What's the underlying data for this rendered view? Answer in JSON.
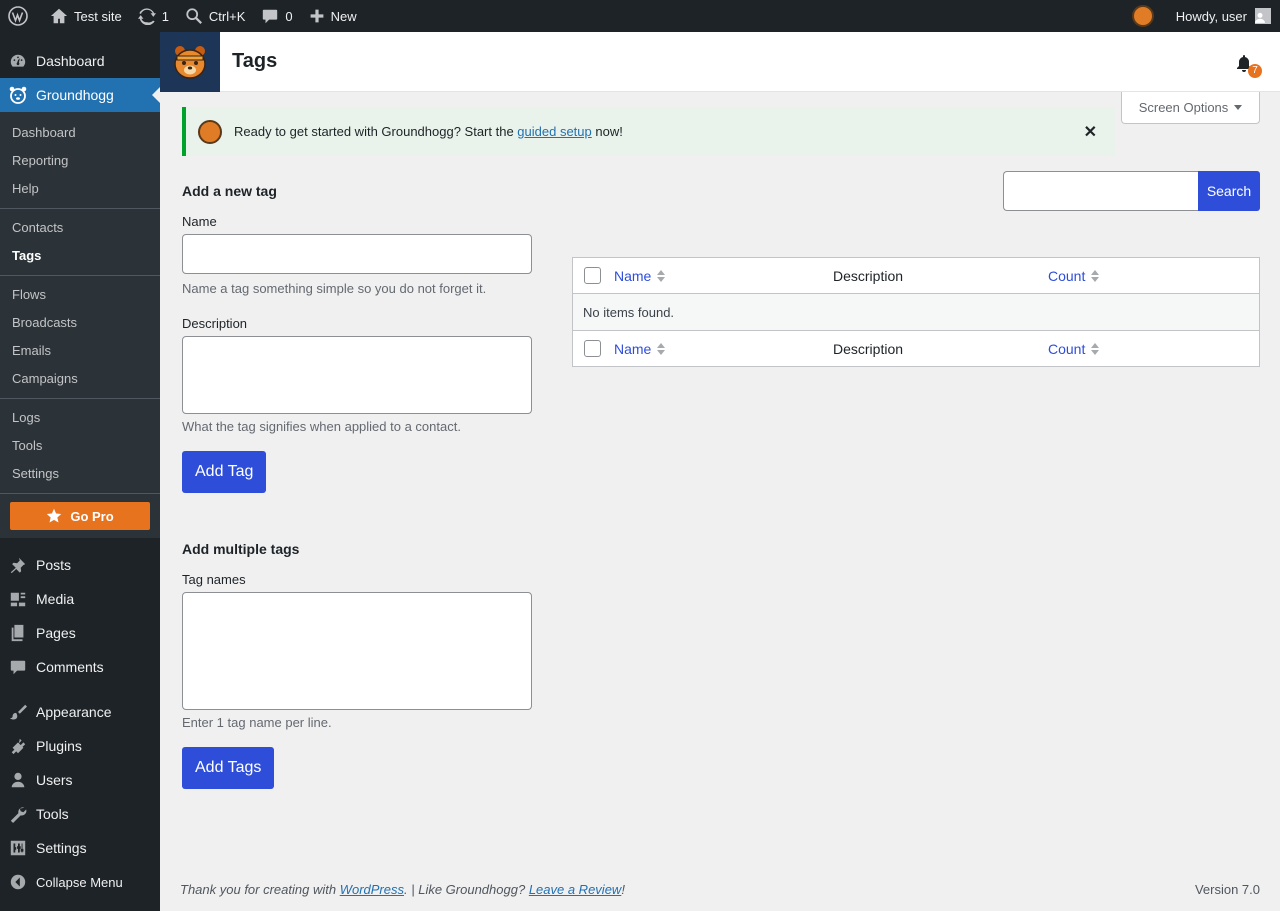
{
  "adminbar": {
    "site_name": "Test site",
    "updates_count": "1",
    "search_shortcut": "Ctrl+K",
    "comments_count": "0",
    "new_label": "New",
    "howdy": "Howdy, user"
  },
  "sidebar": {
    "dashboard": "Dashboard",
    "groundhogg": "Groundhogg",
    "sub_group1": [
      "Dashboard",
      "Reporting",
      "Help"
    ],
    "sub_group2": [
      "Contacts",
      "Tags"
    ],
    "sub_group3": [
      "Flows",
      "Broadcasts",
      "Emails",
      "Campaigns"
    ],
    "sub_group4": [
      "Logs",
      "Tools",
      "Settings"
    ],
    "go_pro": "Go Pro",
    "menu": [
      {
        "label": "Posts",
        "icon": "pin-icon"
      },
      {
        "label": "Media",
        "icon": "media-icon"
      },
      {
        "label": "Pages",
        "icon": "pages-icon"
      },
      {
        "label": "Comments",
        "icon": "comment-icon"
      },
      {
        "label": "Appearance",
        "icon": "brush-icon"
      },
      {
        "label": "Plugins",
        "icon": "plugin-icon"
      },
      {
        "label": "Users",
        "icon": "user-icon"
      },
      {
        "label": "Tools",
        "icon": "wrench-icon"
      },
      {
        "label": "Settings",
        "icon": "sliders-icon"
      }
    ],
    "collapse": "Collapse Menu"
  },
  "header": {
    "title": "Tags",
    "notification_count": "7",
    "screen_options": "Screen Options"
  },
  "notice": {
    "text_before": "Ready to get started with Groundhogg? Start the",
    "link": "guided setup",
    "text_after": "now!"
  },
  "add_tag": {
    "heading": "Add a new tag",
    "name_label": "Name",
    "name_value": "",
    "name_desc": "Name a tag something simple so you do not forget it.",
    "description_label": "Description",
    "description_value": "",
    "description_desc": "What the tag signifies when applied to a contact.",
    "button": "Add Tag"
  },
  "add_multiple": {
    "heading": "Add multiple tags",
    "label": "Tag names",
    "value": "",
    "desc": "Enter 1 tag name per line.",
    "button": "Add Tags"
  },
  "search": {
    "value": "",
    "button": "Search"
  },
  "table": {
    "columns": [
      "Name",
      "Description",
      "Count"
    ],
    "empty_message": "No items found."
  },
  "footer": {
    "thanks_before": "Thank you for creating with",
    "wordpress": "WordPress",
    "like": ". | Like Groundhogg?",
    "review": "Leave a Review",
    "excl": "!",
    "version": "Version 7.0"
  },
  "colors": {
    "primary": "#2e4eda",
    "accent": "#e8731f",
    "sidebar_bg": "#1d2327",
    "current_menu": "#2271b1"
  }
}
